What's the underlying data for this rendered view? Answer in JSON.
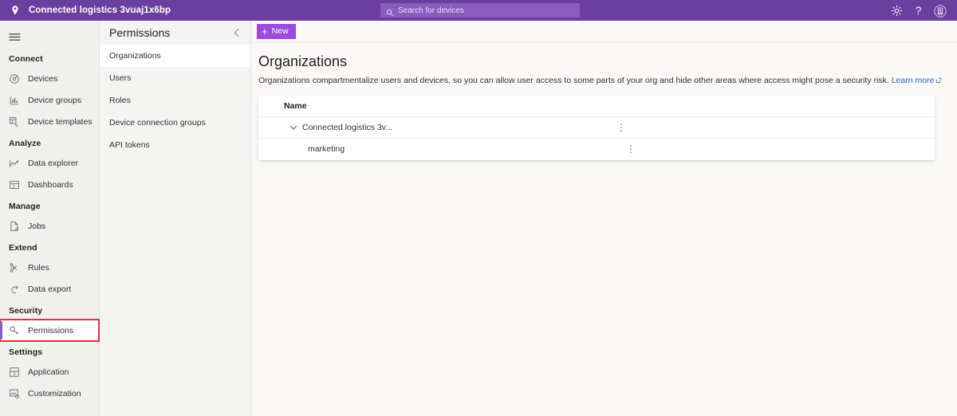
{
  "header": {
    "title": "Connected logistics 3vuaj1x6bp",
    "pin_icon": "location-pin-icon",
    "search": {
      "placeholder": "Search for devices",
      "value": "",
      "icon": "search-icon"
    },
    "actions": [
      {
        "name": "settings-gear-icon",
        "label": ""
      },
      {
        "name": "help-icon",
        "label": "?"
      },
      {
        "name": "account-badge-icon",
        "label": ""
      }
    ]
  },
  "sidebar": {
    "menu_icon": "hamburger-menu-icon",
    "groups": [
      {
        "label": "Connect",
        "items": [
          {
            "label": "Devices",
            "icon": "devices-icon",
            "selected": false
          },
          {
            "label": "Device groups",
            "icon": "device-groups-icon",
            "selected": false
          },
          {
            "label": "Device templates",
            "icon": "device-templates-icon",
            "selected": false
          }
        ]
      },
      {
        "label": "Analyze",
        "items": [
          {
            "label": "Data explorer",
            "icon": "data-explorer-icon",
            "selected": false
          },
          {
            "label": "Dashboards",
            "icon": "dashboards-icon",
            "selected": false
          }
        ]
      },
      {
        "label": "Manage",
        "items": [
          {
            "label": "Jobs",
            "icon": "jobs-icon",
            "selected": false
          }
        ]
      },
      {
        "label": "Extend",
        "items": [
          {
            "label": "Rules",
            "icon": "rules-icon",
            "selected": false
          },
          {
            "label": "Data export",
            "icon": "data-export-icon",
            "selected": false
          }
        ]
      },
      {
        "label": "Security",
        "items": [
          {
            "label": "Permissions",
            "icon": "key-icon",
            "selected": true,
            "highlighted": true
          }
        ]
      },
      {
        "label": "Settings",
        "items": [
          {
            "label": "Application",
            "icon": "application-icon",
            "selected": false
          },
          {
            "label": "Customization",
            "icon": "customization-icon",
            "selected": false
          }
        ]
      }
    ]
  },
  "subpanel": {
    "title": "Permissions",
    "collapse_icon": "chevron-left-icon",
    "items": [
      {
        "label": "Organizations",
        "selected": true
      },
      {
        "label": "Users",
        "selected": false
      },
      {
        "label": "Roles",
        "selected": false
      },
      {
        "label": "Device connection groups",
        "selected": false
      },
      {
        "label": "API tokens",
        "selected": false
      }
    ]
  },
  "main": {
    "commandbar": {
      "new_label": "New",
      "new_icon": "plus-icon"
    },
    "page_title": "Organizations",
    "description": "Organizations compartmentalize users and devices, so you can allow user access to some parts of your org and hide other areas where access might pose a security risk.",
    "learn_more_label": "Learn more",
    "learn_more_icon": "external-link-icon",
    "table": {
      "columns": [
        "Name"
      ],
      "rows": [
        {
          "name": "Connected logistics 3v...",
          "level": 1,
          "expanded": true,
          "chevron_icon": "chevron-down-icon",
          "menu_icon": "more-vertical-icon",
          "menu_label": "⋮"
        },
        {
          "name": "marketing",
          "level": 2,
          "expanded": false,
          "chevron_icon": "",
          "menu_icon": "more-vertical-icon",
          "menu_label": "⋮"
        }
      ]
    }
  },
  "colors": {
    "brand_header": "#6b3fa0",
    "search_field": "#8a5cc0",
    "accent_button": "#9b4ce0",
    "selection_bar": "#8661c5",
    "highlight_box": "#ee2b3c",
    "link": "#2a5fd0",
    "sidebar_bg": "#f0f0ef",
    "subpanel_bg": "#f4f4f3",
    "main_bg": "#faf9f8"
  }
}
